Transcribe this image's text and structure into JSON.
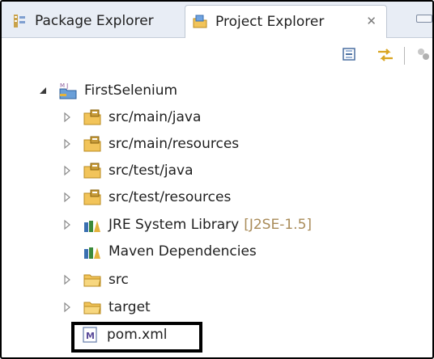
{
  "tabs": {
    "package_explorer": "Package Explorer",
    "project_explorer": "Project Explorer",
    "close_glyph": "✕"
  },
  "tree": {
    "project": "FirstSelenium",
    "items": [
      {
        "label": "src/main/java",
        "icon": "source-folder-icon"
      },
      {
        "label": "src/main/resources",
        "icon": "source-folder-icon"
      },
      {
        "label": "src/test/java",
        "icon": "source-folder-icon"
      },
      {
        "label": "src/test/resources",
        "icon": "source-folder-icon"
      },
      {
        "label": "JRE System Library",
        "suffix": "[J2SE-1.5]",
        "icon": "library-icon"
      },
      {
        "label": "Maven Dependencies",
        "icon": "library-icon"
      },
      {
        "label": "src",
        "icon": "folder-icon"
      },
      {
        "label": "target",
        "icon": "folder-icon"
      },
      {
        "label": "pom.xml",
        "icon": "maven-file-icon"
      }
    ]
  },
  "colors": {
    "accent_folder": "#e8b84a",
    "library_green": "#3a8a3a",
    "library_yellow": "#e3b33d",
    "suffix": "#a98b59",
    "highlight_border": "#000000"
  }
}
